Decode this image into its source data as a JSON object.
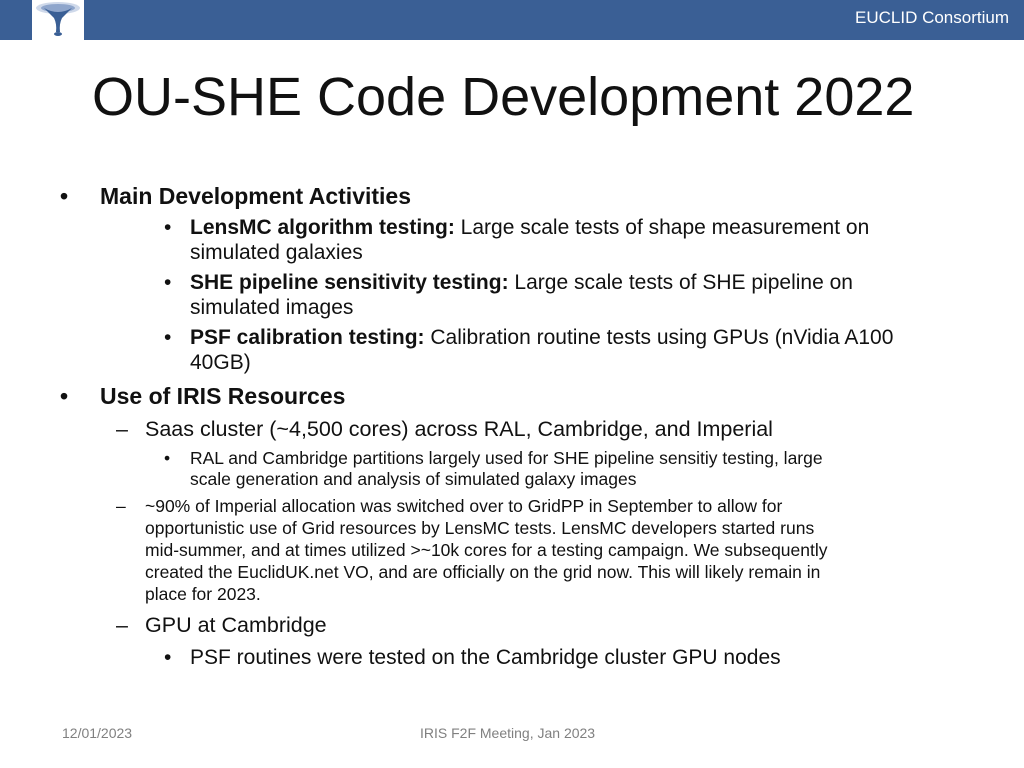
{
  "header": {
    "org": "EUCLID Consortium",
    "brand_color": "#3a5f95"
  },
  "title": "OU-SHE Code Development 2022",
  "sections": [
    {
      "heading": "Main Development Activities",
      "items": [
        {
          "label": "LensMC algorithm testing:",
          "line1": " Large scale tests of shape measurement on",
          "line2": "simulated galaxies"
        },
        {
          "label": "SHE pipeline sensitivity testing:",
          "line1": " Large scale tests of SHE pipeline on",
          "line2": "simulated images"
        },
        {
          "label": "PSF calibration testing:",
          "line1": " Calibration routine tests using GPUs (nVidia A100",
          "line2": "40GB)"
        }
      ]
    },
    {
      "heading": "Use of IRIS Resources",
      "saas": {
        "text": "Saas cluster (~4,500 cores) across RAL, Cambridge, and Imperial",
        "sub": [
          "RAL and Cambridge partitions largely used for SHE pipeline sensitiy testing, large",
          "scale generation and analysis of simulated galaxy images"
        ]
      },
      "imperial": [
        "~90% of Imperial allocation was switched over to GridPP in September to allow for",
        "opportunistic use of Grid resources by LensMC tests. LensMC developers started runs",
        "mid-summer, and at times utilized >~10k cores for a testing campaign. We subsequently",
        "created the EuclidUK.net VO, and are officially on the grid now. This will likely remain in",
        "place for 2023."
      ],
      "gpu": {
        "text": "GPU at Cambridge",
        "sub": "PSF routines were tested on the Cambridge cluster GPU nodes"
      }
    }
  ],
  "footer": {
    "date": "12/01/2023",
    "meeting": "IRIS F2F Meeting, Jan 2023"
  },
  "glyphs": {
    "bullet": "•",
    "dash": "–"
  }
}
